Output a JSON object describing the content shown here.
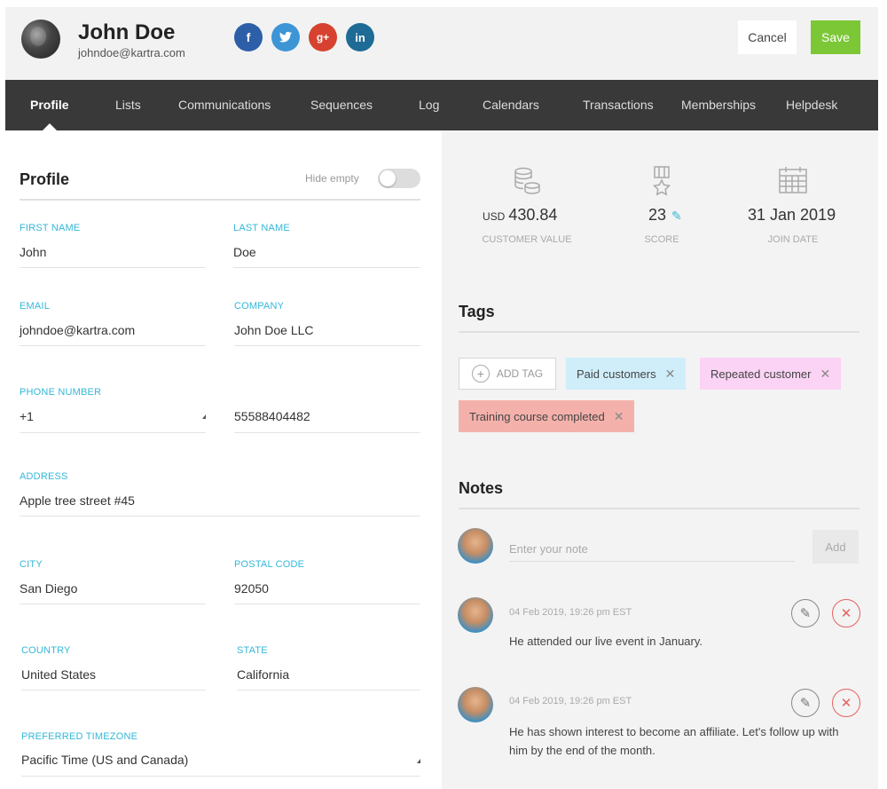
{
  "header": {
    "name": "John Doe",
    "email": "johndoe@kartra.com",
    "social": [
      "f",
      "t",
      "g+",
      "in"
    ],
    "cancel_label": "Cancel",
    "save_label": "Save"
  },
  "nav": {
    "tabs": [
      "Profile",
      "Lists",
      "Communications",
      "Sequences",
      "Log",
      "Calendars",
      "Transactions",
      "Memberships",
      "Helpdesk"
    ],
    "active": "Profile"
  },
  "profile": {
    "title": "Profile",
    "hide_empty_label": "Hide empty",
    "fields": {
      "first_name": {
        "label": "FIRST NAME",
        "value": "John"
      },
      "last_name": {
        "label": "LAST NAME",
        "value": "Doe"
      },
      "email": {
        "label": "EMAIL",
        "value": "johndoe@kartra.com"
      },
      "company": {
        "label": "COMPANY",
        "value": "John Doe LLC"
      },
      "phone": {
        "label": "PHONE NUMBER",
        "code": "+1",
        "value": "55588404482"
      },
      "address": {
        "label": "ADDRESS",
        "value": "Apple tree street #45"
      },
      "city": {
        "label": "CITY",
        "value": "San Diego"
      },
      "postal_code": {
        "label": "POSTAL CODE",
        "value": "92050"
      },
      "country": {
        "label": "COUNTRY",
        "value": "United States"
      },
      "state": {
        "label": "STATE",
        "value": "California"
      },
      "timezone": {
        "label": "PREFERRED TIMEZONE",
        "value": "Pacific Time (US and Canada)"
      }
    }
  },
  "stats": {
    "customer_value": {
      "prefix": "USD",
      "value": "430.84",
      "label": "CUSTOMER VALUE"
    },
    "score": {
      "value": "23",
      "label": "SCORE"
    },
    "join_date": {
      "value": "31 Jan 2019",
      "label": "JOIN DATE"
    }
  },
  "tags": {
    "title": "Tags",
    "add_label": "ADD TAG",
    "items": [
      {
        "label": "Paid customers",
        "color": "#cfeefa"
      },
      {
        "label": "Repeated customer",
        "color": "#fbd3f4"
      },
      {
        "label": "Training course completed",
        "color": "#f4b1ab"
      }
    ]
  },
  "notes": {
    "title": "Notes",
    "placeholder": "Enter your note",
    "add_label": "Add",
    "items": [
      {
        "timestamp": "04 Feb 2019, 19:26 pm EST",
        "text": "He attended our live event in January."
      },
      {
        "timestamp": "04 Feb 2019, 19:26 pm EST",
        "text": "He has shown interest to become an affiliate. Let's follow up with him by the end of the month."
      }
    ]
  },
  "colors": {
    "accent": "#34b7d8",
    "save": "#7cc736",
    "nav_bg": "#393939",
    "delete": "#e86060"
  }
}
